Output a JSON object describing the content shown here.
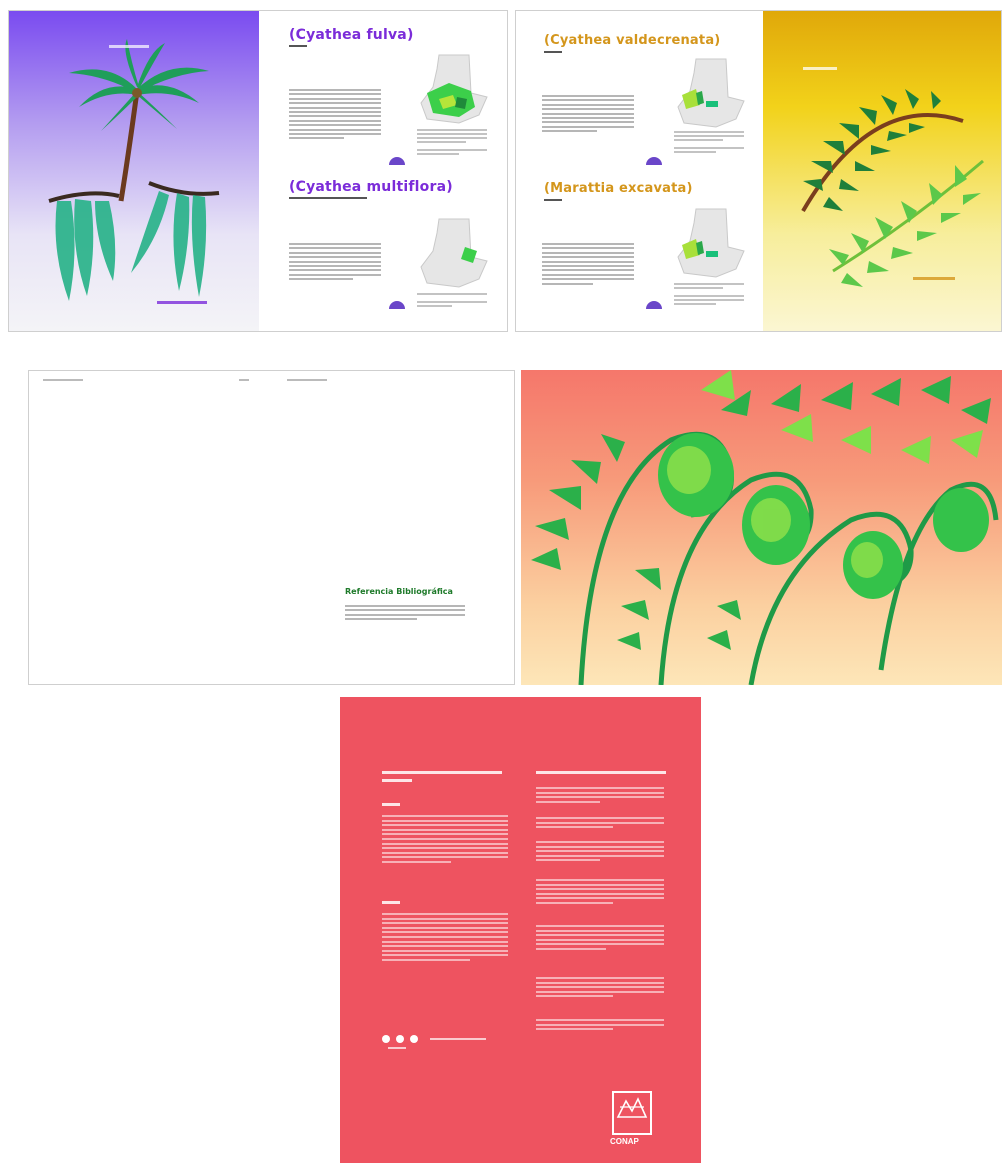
{
  "spread1": {
    "left_page": {
      "top_label": "",
      "bottom_label": ""
    },
    "right_page": {
      "species1_title": "(Cyathea fulva)",
      "species2_title": "(Cyathea multiflora)"
    }
  },
  "spread2": {
    "left_page": {
      "species1_title": "(Cyathea valdecrenata)",
      "species2_title": "(Marattia excavata)"
    }
  },
  "spread3": {
    "right_text": {
      "heading": "Referencia Bibliográfica"
    }
  },
  "back_cover": {
    "logo_text": "CONAP"
  },
  "colors": {
    "purple": "#7b2cd9",
    "orange_gold": "#d4961c",
    "ref_green": "#1e7a2a",
    "back_cover_red": "#ee5360"
  }
}
